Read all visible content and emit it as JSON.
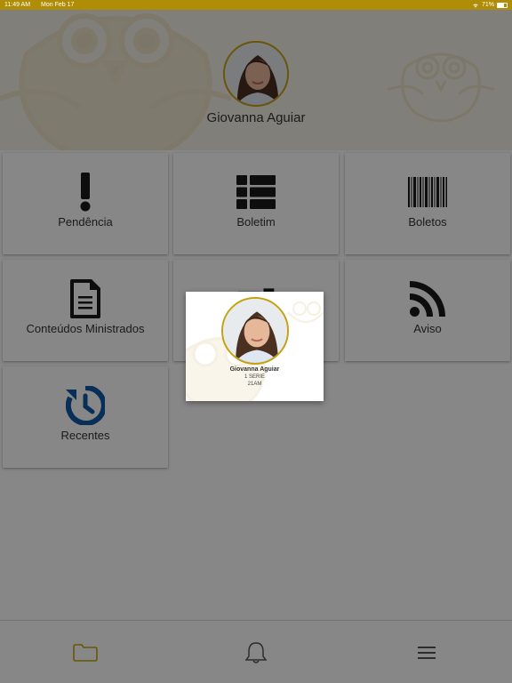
{
  "status": {
    "time": "11:49 AM",
    "date": "Mon Feb 17",
    "battery": "71%"
  },
  "profile": {
    "name": "Giovanna Aguiar",
    "avatar": "student-photo"
  },
  "tiles": [
    {
      "label": "Pendência",
      "icon": "exclamation-icon"
    },
    {
      "label": "Boletim",
      "icon": "table-list-icon"
    },
    {
      "label": "Boletos",
      "icon": "barcode-icon"
    },
    {
      "label": "Conteúdos Ministrados",
      "icon": "document-icon"
    },
    {
      "label": "",
      "icon": "hidden-tile-icon"
    },
    {
      "label": "Aviso",
      "icon": "rss-icon"
    },
    {
      "label": "Recentes",
      "icon": "history-icon"
    }
  ],
  "student_card": {
    "name": "Giovanna Aguiar",
    "grade": "1 SERIE",
    "class": "21AM"
  },
  "bottom_nav": [
    {
      "icon": "folder-icon",
      "active": true
    },
    {
      "icon": "bell-icon",
      "active": false
    },
    {
      "icon": "menu-icon",
      "active": false
    }
  ],
  "colors": {
    "accent": "#c6a10f",
    "icon_dark": "#1a1a1a",
    "icon_blue": "#0e5aa7",
    "status_bar": "#b08d06"
  }
}
